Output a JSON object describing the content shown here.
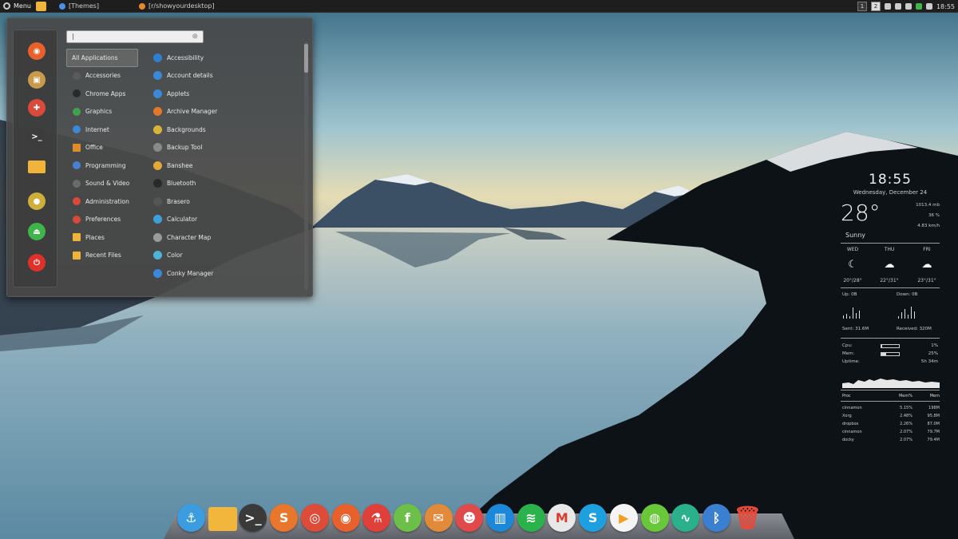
{
  "top_panel": {
    "menu_label": "Menu",
    "tasks": [
      {
        "label": "[Themes]"
      },
      {
        "label": "[r/showyourdesktop] li..."
      }
    ],
    "workspaces": [
      "1",
      "2"
    ],
    "clock": "18:55"
  },
  "search": {
    "value": "|",
    "placeholder": ""
  },
  "categories": [
    {
      "label": "All Applications",
      "color": "#777777"
    },
    {
      "label": "Accessories",
      "color": "#5a5a5a"
    },
    {
      "label": "Chrome Apps",
      "color": "#2a2a2a"
    },
    {
      "label": "Graphics",
      "color": "#3fa34d"
    },
    {
      "label": "Internet",
      "color": "#3b88d8"
    },
    {
      "label": "Office",
      "color": "#e08a2a"
    },
    {
      "label": "Programming",
      "color": "#4a7fd0"
    },
    {
      "label": "Sound & Video",
      "color": "#6a6a6a"
    },
    {
      "label": "Administration",
      "color": "#d94a3a"
    },
    {
      "label": "Preferences",
      "color": "#d94a3a"
    },
    {
      "label": "Places",
      "color": "#f0b43a"
    },
    {
      "label": "Recent Files",
      "color": "#f0b43a"
    }
  ],
  "apps": [
    {
      "label": "Accessibility",
      "color": "#2f7fd1"
    },
    {
      "label": "Account details",
      "color": "#3b88d8"
    },
    {
      "label": "Applets",
      "color": "#3b88d8"
    },
    {
      "label": "Archive Manager",
      "color": "#e07a2a"
    },
    {
      "label": "Backgrounds",
      "color": "#d9b43a"
    },
    {
      "label": "Backup Tool",
      "color": "#8a8a8a"
    },
    {
      "label": "Banshee",
      "color": "#e0a93a"
    },
    {
      "label": "Bluetooth",
      "color": "#2a2a2a"
    },
    {
      "label": "Brasero",
      "color": "#555555"
    },
    {
      "label": "Calculator",
      "color": "#3fa0d8"
    },
    {
      "label": "Character Map",
      "color": "#9a9a9a"
    },
    {
      "label": "Color",
      "color": "#4fb4d8"
    },
    {
      "label": "Conky Manager",
      "color": "#3b88d8"
    }
  ],
  "favorites": [
    {
      "name": "firefox",
      "color": "#e8612c",
      "glyph": "◉"
    },
    {
      "name": "image-viewer",
      "color": "#c99a4a",
      "glyph": "▣"
    },
    {
      "name": "software-center",
      "color": "#d94a3a",
      "glyph": "✚"
    },
    {
      "name": "terminal",
      "color": "#3c3c3c",
      "glyph": ">_"
    },
    {
      "name": "files",
      "color": "#f0b43a",
      "glyph": ""
    },
    {
      "name": "lock-screen",
      "color": "#cfae3a",
      "glyph": "●"
    },
    {
      "name": "logout",
      "color": "#3fb44b",
      "glyph": "⏏"
    },
    {
      "name": "shutdown",
      "color": "#e0302a",
      "glyph": "⏻"
    }
  ],
  "conky": {
    "time": "18:55",
    "date": "Wednesday, December 24",
    "temperature": "28°",
    "condition": "Sunny",
    "pressure": "1013.4 mb",
    "humidity": "36 %",
    "wind": "4.83 km/h",
    "forecast": [
      {
        "day": "WED",
        "icon": "moon-icon",
        "glyph": "☾",
        "temps": "20°/28°"
      },
      {
        "day": "THU",
        "icon": "storm-icon",
        "glyph": "☁",
        "temps": "22°/31°"
      },
      {
        "day": "FRI",
        "icon": "storm-icon",
        "glyph": "☁",
        "temps": "23°/31°"
      }
    ],
    "net_up": "Up: 0B",
    "net_down": "Down: 0B",
    "sent": "Sent: 31.6M",
    "received": "Received: 320M",
    "cpu_label": "Cpu:",
    "cpu_value": "1%",
    "cpu_fraction": 0.01,
    "mem_label": "Mem:",
    "mem_value": "25%",
    "mem_fraction": 0.25,
    "uptime_label": "Uptime:",
    "uptime_value": "5h 34m",
    "proc_header": [
      "Proc",
      "Mem%",
      "Mem"
    ],
    "processes": [
      [
        "cinnamon",
        "5.15%",
        "198M"
      ],
      [
        "Xorg",
        "2.48%",
        "95.8M"
      ],
      [
        "dropbox",
        "2.26%",
        "87.0M"
      ],
      [
        "cinnamon",
        "2.07%",
        "79.7M"
      ],
      [
        "docky",
        "2.07%",
        "79.4M"
      ]
    ]
  },
  "dock": [
    {
      "name": "anchor-app",
      "color": "#3b9de0",
      "glyph": "⚓"
    },
    {
      "name": "files",
      "color": "#f2b63c",
      "glyph": ""
    },
    {
      "name": "terminal",
      "color": "#3a3a3a",
      "glyph": ">_"
    },
    {
      "name": "sublime-text",
      "color": "#e8762c",
      "glyph": "S"
    },
    {
      "name": "chrome",
      "color": "#dd4b39",
      "glyph": "◎"
    },
    {
      "name": "firefox",
      "color": "#e8612c",
      "glyph": "◉"
    },
    {
      "name": "lab-app",
      "color": "#e0403a",
      "glyph": "⚗"
    },
    {
      "name": "feedly",
      "color": "#6cc04a",
      "glyph": "f"
    },
    {
      "name": "mail-app",
      "color": "#e08a3a",
      "glyph": "✉"
    },
    {
      "name": "games-app",
      "color": "#e04a4a",
      "glyph": "☻"
    },
    {
      "name": "trello",
      "color": "#1e88d8",
      "glyph": "▥"
    },
    {
      "name": "spotify",
      "color": "#2bb24c",
      "glyph": "≋"
    },
    {
      "name": "gmail",
      "color": "#e8e8e8",
      "glyph": "M"
    },
    {
      "name": "skype",
      "color": "#1ea0e0",
      "glyph": "S"
    },
    {
      "name": "media-player",
      "color": "#f0a020",
      "glyph": "▶"
    },
    {
      "name": "vpn-app",
      "color": "#68c83a",
      "glyph": "◍"
    },
    {
      "name": "system-monitor",
      "color": "#2ab08a",
      "glyph": "∿"
    },
    {
      "name": "bluetooth",
      "color": "#3b7fd0",
      "glyph": "ᛒ"
    },
    {
      "name": "trash",
      "color": "#e84a3a",
      "glyph": "🗑"
    }
  ]
}
